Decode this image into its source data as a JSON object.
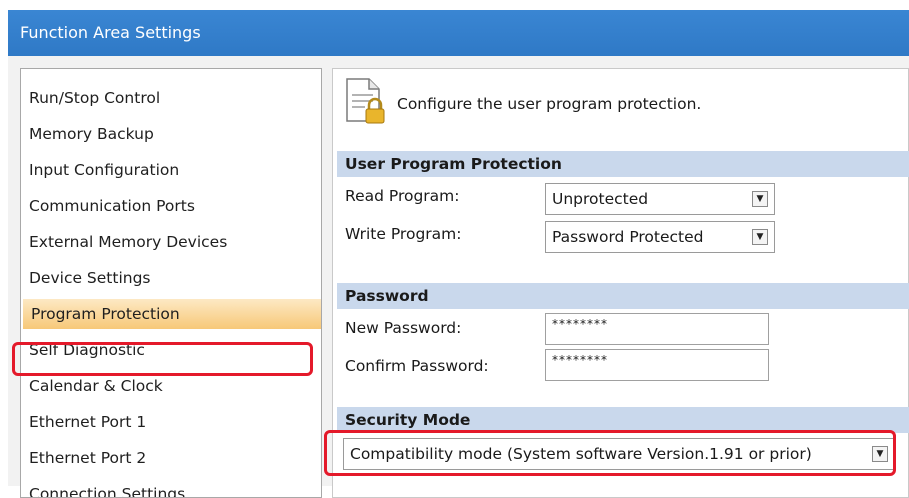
{
  "window": {
    "title": "Function Area Settings"
  },
  "sidebar": {
    "items": [
      {
        "label": "Run/Stop Control"
      },
      {
        "label": "Memory Backup"
      },
      {
        "label": "Input Configuration"
      },
      {
        "label": "Communication Ports"
      },
      {
        "label": "External Memory Devices"
      },
      {
        "label": "Device Settings"
      },
      {
        "label": "Program Protection",
        "selected": true
      },
      {
        "label": "Self Diagnostic"
      },
      {
        "label": "Calendar & Clock"
      },
      {
        "label": "Ethernet Port 1"
      },
      {
        "label": "Ethernet Port 2"
      },
      {
        "label": "Connection Settings"
      }
    ]
  },
  "panel": {
    "icon": "document-lock-icon",
    "description": "Configure the user program protection.",
    "user_program_protection": {
      "header": "User Program Protection",
      "read_label": "Read Program:",
      "read_value": "Unprotected",
      "write_label": "Write Program:",
      "write_value": "Password Protected"
    },
    "password": {
      "header": "Password",
      "new_label": "New Password:",
      "new_value": "********",
      "confirm_label": "Confirm Password:",
      "confirm_value": "********"
    },
    "security_mode": {
      "header": "Security Mode",
      "value": "Compatibility mode (System software Version.1.91 or prior)"
    }
  },
  "colors": {
    "title_bar": "#2f79c6",
    "section_header": "#c9d8ec",
    "selected_item": "#f7c878",
    "highlight": "#e4192a"
  }
}
